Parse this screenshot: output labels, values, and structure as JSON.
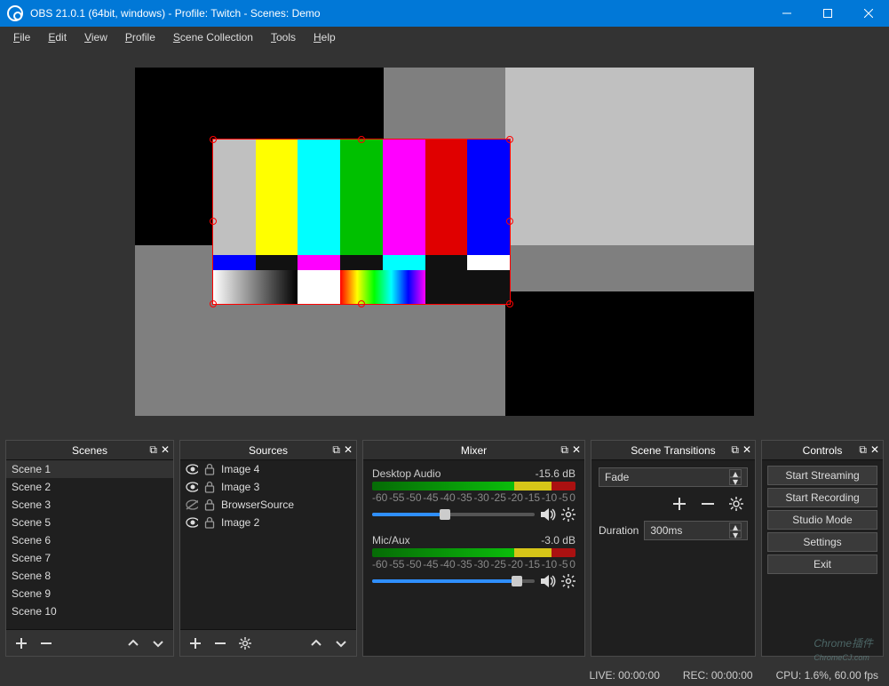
{
  "titlebar": {
    "text": "OBS 21.0.1 (64bit, windows) - Profile: Twitch - Scenes: Demo"
  },
  "menu": [
    "File",
    "Edit",
    "View",
    "Profile",
    "Scene Collection",
    "Tools",
    "Help"
  ],
  "panels": {
    "scenes": {
      "title": "Scenes",
      "items": [
        "Scene 1",
        "Scene 2",
        "Scene 3",
        "Scene 5",
        "Scene 6",
        "Scene 7",
        "Scene 8",
        "Scene 9",
        "Scene 10"
      ]
    },
    "sources": {
      "title": "Sources",
      "items": [
        {
          "label": "Image 4",
          "visible": true,
          "locked": true
        },
        {
          "label": "Image 3",
          "visible": true,
          "locked": true
        },
        {
          "label": "BrowserSource",
          "visible": false,
          "locked": true
        },
        {
          "label": "Image 2",
          "visible": true,
          "locked": true
        }
      ]
    },
    "mixer": {
      "title": "Mixer",
      "channels": [
        {
          "name": "Desktop Audio",
          "db": "-15.6 dB",
          "slider": 45
        },
        {
          "name": "Mic/Aux",
          "db": "-3.0 dB",
          "slider": 89
        }
      ],
      "ticks": [
        "-60",
        "-55",
        "-50",
        "-45",
        "-40",
        "-35",
        "-30",
        "-25",
        "-20",
        "-15",
        "-10",
        "-5",
        "0"
      ]
    },
    "transitions": {
      "title": "Scene Transitions",
      "selected": "Fade",
      "duration_label": "Duration",
      "duration_value": "300ms"
    },
    "controls": {
      "title": "Controls",
      "buttons": [
        "Start Streaming",
        "Start Recording",
        "Studio Mode",
        "Settings",
        "Exit"
      ]
    }
  },
  "status": {
    "live": "LIVE: 00:00:00",
    "rec": "REC: 00:00:00",
    "cpu": "CPU: 1.6%, 60.00 fps"
  }
}
